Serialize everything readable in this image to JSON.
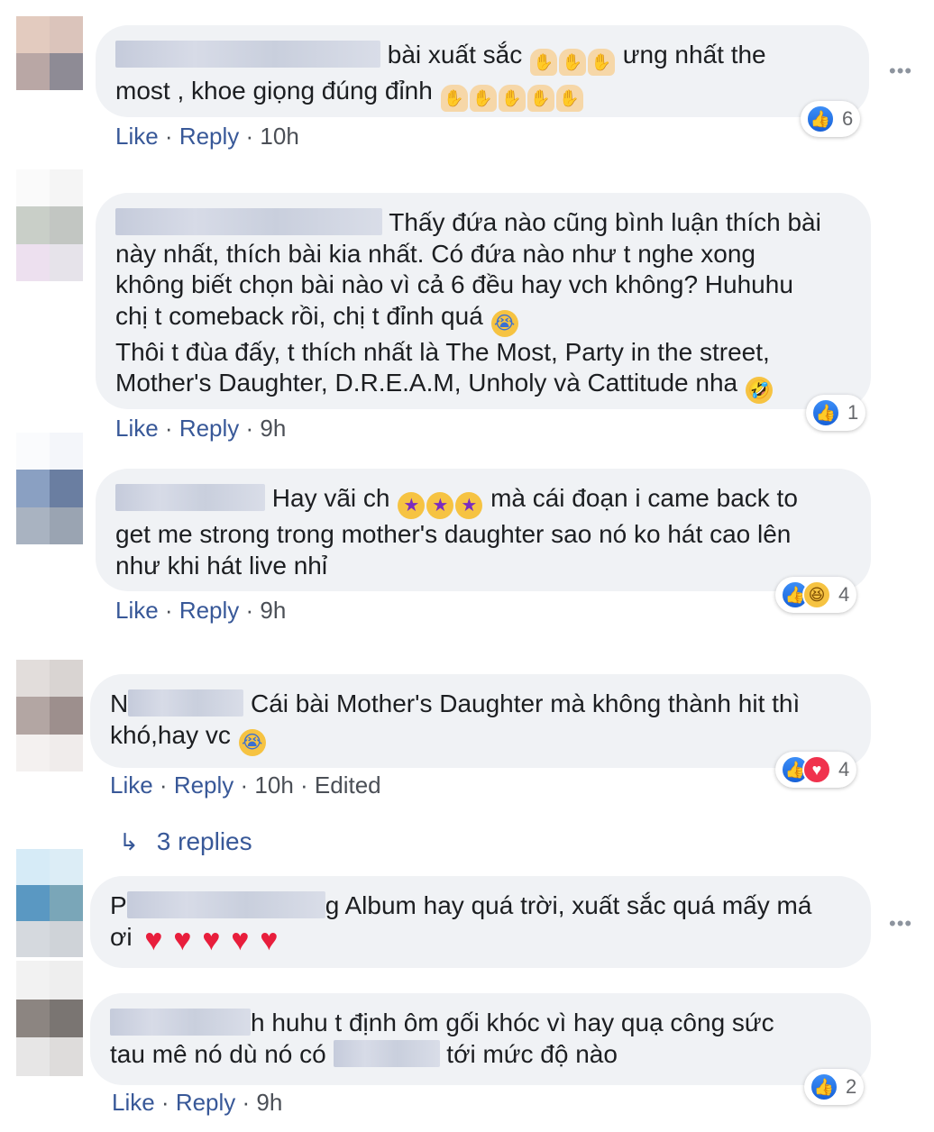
{
  "comments": [
    {
      "segments": [
        "bài xuất sắc",
        "ưng nhất the",
        "most , khoe giọng đúng đỉnh"
      ],
      "like_label": "Like",
      "reply_label": "Reply",
      "time": "10h",
      "reaction_count": "6"
    },
    {
      "lines": [
        "Thấy đứa nào cũng bình luận thích bài",
        "này nhất, thích bài kia nhất. Có đứa nào như t nghe xong",
        "không biết chọn bài nào vì cả 6 đều hay vch không? Huhuhu",
        "chị t comeback rồi, chị t đỉnh quá",
        "Thôi t đùa đấy, t thích nhất là The Most, Party in the street,",
        "Mother's Daughter, D.R.E.A.M, Unholy và Cattitude nha"
      ],
      "like_label": "Like",
      "reply_label": "Reply",
      "time": "9h",
      "reaction_count": "1"
    },
    {
      "lines": [
        "Hay vãi ch",
        "mà cái đoạn i came back to",
        "get me strong trong mother's daughter sao nó ko hát cao lên",
        "như khi hát live nhỉ"
      ],
      "like_label": "Like",
      "reply_label": "Reply",
      "time": "9h",
      "reaction_count": "4"
    },
    {
      "name_initial": "N",
      "lines": [
        "Cái bài Mother's Daughter mà không thành hit thì",
        "khó,hay vc"
      ],
      "like_label": "Like",
      "reply_label": "Reply",
      "time": "10h",
      "edited": "Edited",
      "reaction_count": "4"
    },
    {
      "name_initial": "P",
      "name_final": "g",
      "lines": [
        "Album hay quá trời, xuất sắc quá mấy má",
        "ơi"
      ]
    },
    {
      "name_final": "h",
      "lines": [
        "huhu t định ôm gối khóc vì hay quạ công sức",
        "tau mê nó dù nó có",
        "tới mức độ nào"
      ],
      "like_label": "Like",
      "reply_label": "Reply",
      "time": "9h",
      "reaction_count": "2"
    }
  ],
  "replies_link": "3 replies",
  "more_icon": "more-options-icon",
  "colors": {
    "link": "#385898",
    "bubble": "#f0f2f5",
    "like_blue": "#1877f2",
    "love_red": "#f0324d"
  }
}
